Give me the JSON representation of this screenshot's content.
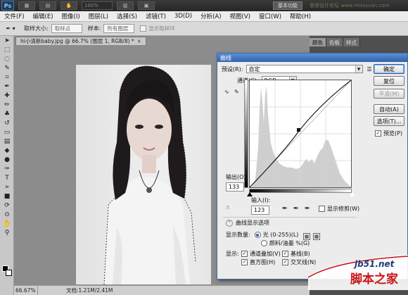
{
  "app": {
    "logo": "Ps",
    "zoom_readout": "100%",
    "workspace_label": "基本功能",
    "watermark_text": "思缘设计论坛 www.missyuan.com"
  },
  "menu": [
    "文件(F)",
    "编辑(E)",
    "图像(I)",
    "图层(L)",
    "选择(S)",
    "滤镜(T)",
    "3D(D)",
    "分析(A)",
    "视图(V)",
    "窗口(W)",
    "帮助(H)"
  ],
  "options": {
    "sample_size_label": "取样大小:",
    "sample_size_value": "取样点",
    "sample_label": "样本:",
    "sample_value": "所有图层",
    "show_ring_label": "显示取样环"
  },
  "document": {
    "tab_title": "hi小清新baby.jpg @ 66.7% (图层 1, RGB/8) *",
    "close_glyph": "×"
  },
  "status": {
    "zoom": "66.67%",
    "doc_info": "文档:1.21M/2.41M"
  },
  "panels": {
    "tabs": [
      "颜色",
      "色板",
      "样式"
    ]
  },
  "curves": {
    "title": "曲线",
    "preset_label": "预设(R):",
    "preset_value": "自定",
    "channel_label": "通道(C):",
    "channel_value": "RGB",
    "output_label": "输出(O):",
    "output_value": "133",
    "input_label": "输入(I):",
    "input_value": "123",
    "show_clipping_label": "显示修剪(W)",
    "display_options_label": "曲线显示选项",
    "show_amount_label": "显示数量:",
    "light_label": "光 (0-255)(L)",
    "pigment_label": "颜料/油墨 %(G)",
    "show_label": "显示:",
    "channel_overlay_label": "通道叠加(V)",
    "baseline_label": "基线(B)",
    "histogram_label": "直方图(H)",
    "intersection_label": "交叉线(N)",
    "buttons": {
      "ok": "确定",
      "reset": "复位",
      "smooth": "平滑(M)",
      "auto": "自动(A)",
      "options": "选项(T)...",
      "preview": "预览(P)"
    }
  },
  "watermark": {
    "site": "jb51.net",
    "name": "脚本之家"
  }
}
